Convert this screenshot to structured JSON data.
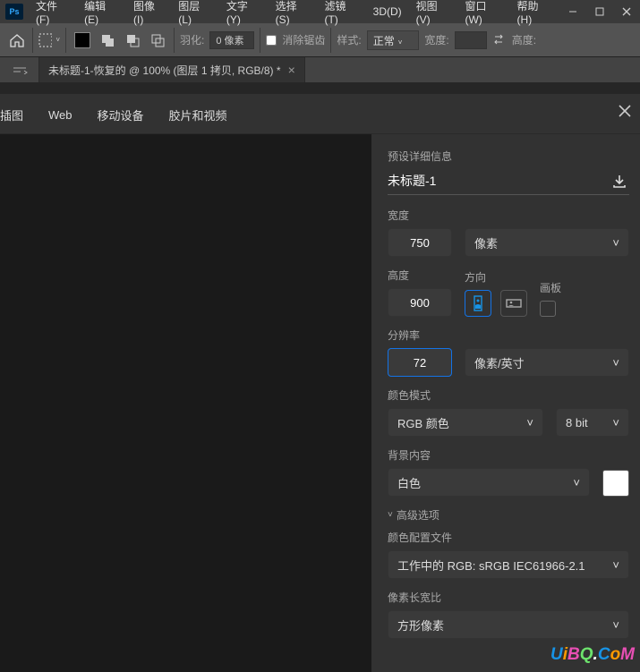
{
  "menubar": {
    "items": [
      "文件(F)",
      "编辑(E)",
      "图像(I)",
      "图层(L)",
      "文字(Y)",
      "选择(S)",
      "滤镜(T)",
      "3D(D)",
      "视图(V)",
      "窗口(W)",
      "帮助(H)"
    ]
  },
  "optionsbar": {
    "feather_label": "羽化:",
    "feather_value": "0 像素",
    "antialias_label": "消除锯齿",
    "style_label": "样式:",
    "style_value": "正常",
    "width_label": "宽度:",
    "height_label": "高度:"
  },
  "tab": {
    "title": "未标题-1-恢复的 @ 100% (图层 1 拷贝, RGB/8) *"
  },
  "dialog": {
    "tabs": [
      "插图",
      "Web",
      "移动设备",
      "胶片和视频"
    ],
    "preset_header": "预设详细信息",
    "doc_name": "未标题-1",
    "width_label": "宽度",
    "width_value": "750",
    "width_unit": "像素",
    "height_label": "高度",
    "height_value": "900",
    "orientation_label": "方向",
    "artboard_label": "画板",
    "resolution_label": "分辨率",
    "resolution_value": "72",
    "resolution_unit": "像素/英寸",
    "color_mode_label": "颜色模式",
    "color_mode_value": "RGB 颜色",
    "bit_depth_value": "8 bit",
    "background_label": "背景内容",
    "background_value": "白色",
    "advanced_label": "高级选项",
    "profile_label": "颜色配置文件",
    "profile_value": "工作中的 RGB: sRGB IEC61966-2.1",
    "aspect_label": "像素长宽比",
    "aspect_value": "方形像素"
  },
  "brand": {
    "text": "UiBQ.CoM"
  }
}
